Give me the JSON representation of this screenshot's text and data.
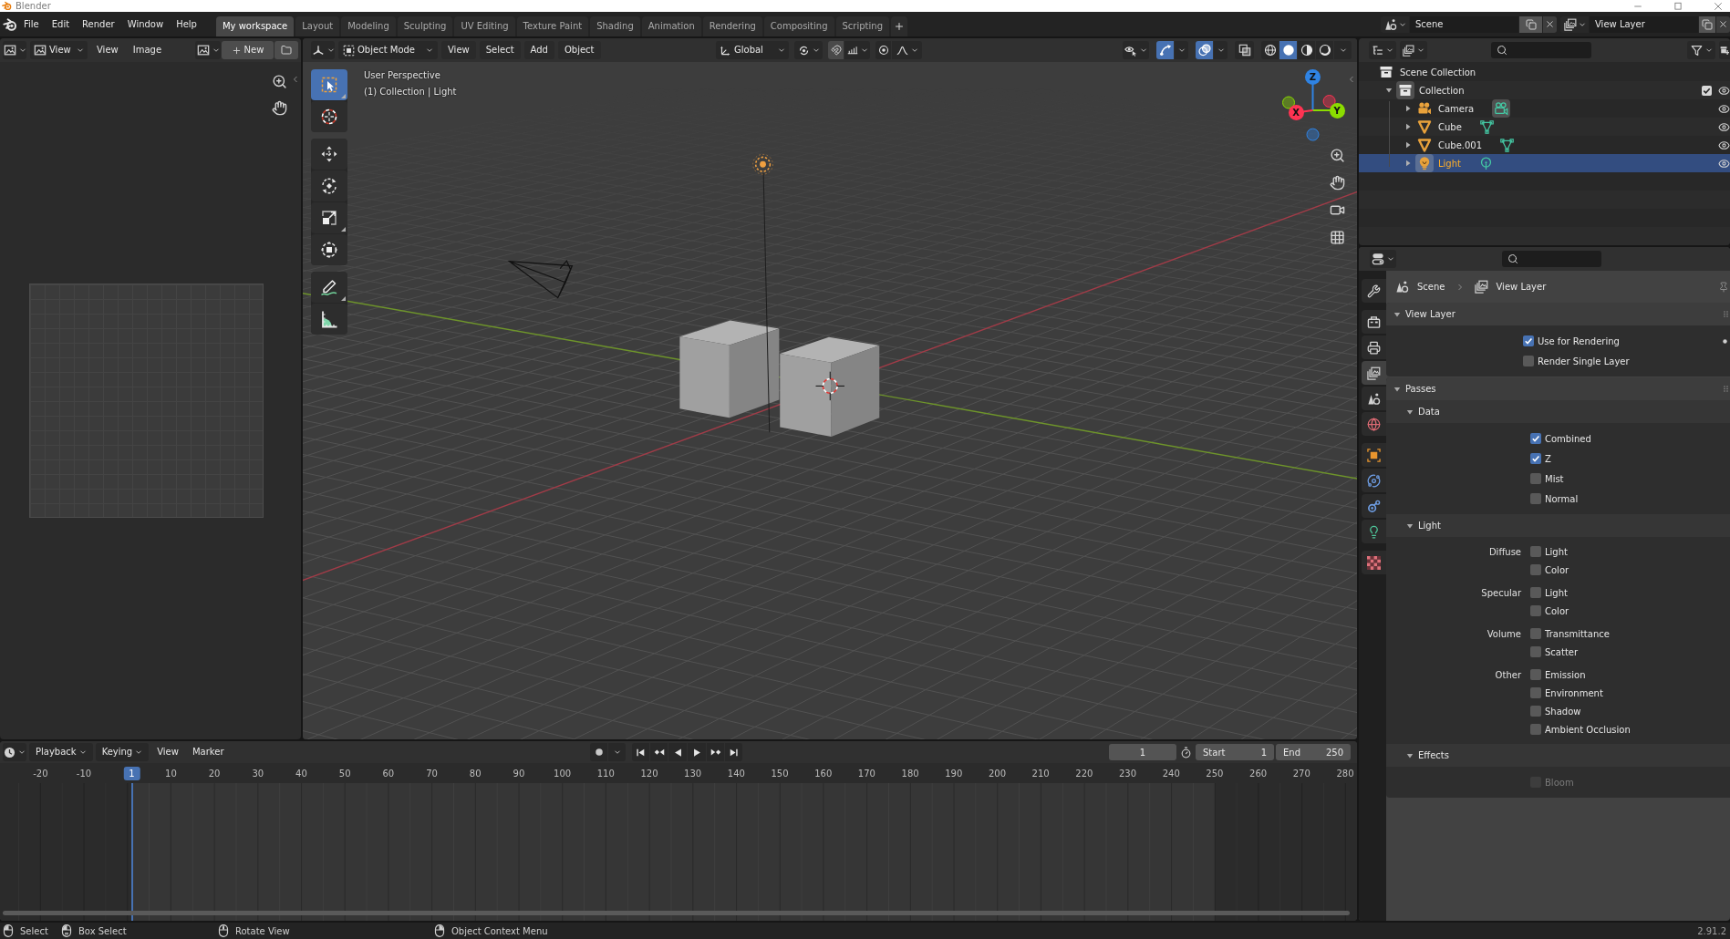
{
  "title_bar": {
    "title": "Blender"
  },
  "top_bar": {
    "menus": [
      "File",
      "Edit",
      "Render",
      "Window",
      "Help"
    ],
    "workspaces": [
      {
        "label": "My workspace",
        "selected": true
      },
      {
        "label": "Layout",
        "selected": false
      },
      {
        "label": "Modeling",
        "selected": false
      },
      {
        "label": "Sculpting",
        "selected": false
      },
      {
        "label": "UV Editing",
        "selected": false
      },
      {
        "label": "Texture Paint",
        "selected": false
      },
      {
        "label": "Shading",
        "selected": false
      },
      {
        "label": "Animation",
        "selected": false
      },
      {
        "label": "Rendering",
        "selected": false
      },
      {
        "label": "Compositing",
        "selected": false
      },
      {
        "label": "Scripting",
        "selected": false
      }
    ],
    "scene": "Scene",
    "view_layer": "View Layer"
  },
  "image_editor": {
    "mode": "View",
    "menus": [
      "View",
      "Image"
    ],
    "new_button": "New"
  },
  "viewport": {
    "mode": "Object Mode",
    "menus": [
      "View",
      "Select",
      "Add",
      "Object"
    ],
    "orientation": "Global",
    "toggles": [
      {
        "kind": "gizmos",
        "on": true
      },
      {
        "kind": "overlays",
        "on": true
      },
      {
        "kind": "xray",
        "on": false
      }
    ],
    "shading": [
      {
        "kind": "wireframe",
        "selected": false
      },
      {
        "kind": "solid",
        "selected": true
      },
      {
        "kind": "material",
        "selected": false
      },
      {
        "kind": "rendered",
        "selected": false
      }
    ],
    "tool_groups": [
      {
        "tools": [
          {
            "kind": "select-box",
            "selected": true,
            "variants": true
          },
          {
            "kind": "cursor",
            "selected": false,
            "variants": false
          }
        ]
      },
      {
        "tools": [
          {
            "kind": "move",
            "selected": false,
            "variants": false
          },
          {
            "kind": "rotate",
            "selected": false,
            "variants": false
          },
          {
            "kind": "scale",
            "selected": false,
            "variants": true
          },
          {
            "kind": "transform",
            "selected": false,
            "variants": false
          }
        ]
      },
      {
        "tools": [
          {
            "kind": "annotate",
            "selected": false,
            "variants": true
          },
          {
            "kind": "measure",
            "selected": false,
            "variants": false
          }
        ]
      }
    ],
    "overlay_text": [
      "User Perspective",
      "(1) Collection | Light"
    ],
    "gizmo_axes": [
      {
        "label": "Z",
        "color": "#2f83e3"
      },
      {
        "label": "Y",
        "color": "#8bdc00"
      },
      {
        "label": "X",
        "color": "#ff3352"
      }
    ]
  },
  "timeline": {
    "menus": [
      {
        "label": "Playback",
        "kind": "dropdown"
      },
      {
        "label": "Keying",
        "kind": "dropdown"
      },
      {
        "label": "View",
        "kind": "menu"
      },
      {
        "label": "Marker",
        "kind": "menu"
      }
    ],
    "auto_keying": {
      "on": false
    },
    "current_frame": "1",
    "start": {
      "label": "Start",
      "value": "1"
    },
    "end": {
      "label": "End",
      "value": "250"
    },
    "ruler": [
      {
        "label": "-20",
        "current": false
      },
      {
        "label": "-10",
        "current": false
      },
      {
        "label": "1",
        "current": true
      },
      {
        "label": "10",
        "current": false
      },
      {
        "label": "20",
        "current": false
      },
      {
        "label": "30",
        "current": false
      },
      {
        "label": "40",
        "current": false
      },
      {
        "label": "50",
        "current": false
      },
      {
        "label": "60",
        "current": false
      },
      {
        "label": "70",
        "current": false
      },
      {
        "label": "80",
        "current": false
      },
      {
        "label": "90",
        "current": false
      },
      {
        "label": "100",
        "current": false
      },
      {
        "label": "110",
        "current": false
      },
      {
        "label": "120",
        "current": false
      },
      {
        "label": "130",
        "current": false
      },
      {
        "label": "140",
        "current": false
      },
      {
        "label": "150",
        "current": false
      },
      {
        "label": "160",
        "current": false
      },
      {
        "label": "170",
        "current": false
      },
      {
        "label": "180",
        "current": false
      },
      {
        "label": "190",
        "current": false
      },
      {
        "label": "200",
        "current": false
      },
      {
        "label": "210",
        "current": false
      },
      {
        "label": "220",
        "current": false
      },
      {
        "label": "230",
        "current": false
      },
      {
        "label": "240",
        "current": false
      },
      {
        "label": "250",
        "current": false
      },
      {
        "label": "260",
        "current": false
      },
      {
        "label": "270",
        "current": false
      },
      {
        "label": "280",
        "current": false
      }
    ]
  },
  "outliner": {
    "tree": [
      {
        "label": "Scene Collection",
        "kind": "scene-collection",
        "selected": false,
        "active": false,
        "children": [
          {
            "label": "Collection",
            "kind": "collection",
            "expanded": true,
            "checked": true,
            "selected": false,
            "active": true,
            "children": [
              {
                "label": "Camera",
                "kind": "camera",
                "expanded": false,
                "selected": false,
                "active": false
              },
              {
                "label": "Cube",
                "kind": "mesh",
                "expanded": false,
                "selected": false,
                "active": false
              },
              {
                "label": "Cube.001",
                "kind": "mesh",
                "expanded": false,
                "selected": false,
                "active": false
              },
              {
                "label": "Light",
                "kind": "light",
                "expanded": false,
                "selected": true,
                "active": true
              }
            ]
          }
        ]
      }
    ]
  },
  "properties": {
    "tab_groups": [
      {
        "tabs": [
          {
            "kind": "tool",
            "selected": false
          }
        ]
      },
      {
        "tabs": [
          {
            "kind": "render",
            "selected": false
          },
          {
            "kind": "output",
            "selected": false
          },
          {
            "kind": "view-layer",
            "selected": true
          },
          {
            "kind": "scene",
            "selected": false
          },
          {
            "kind": "world",
            "selected": false
          }
        ]
      },
      {
        "tabs": [
          {
            "kind": "object",
            "selected": false
          },
          {
            "kind": "physics",
            "selected": false
          },
          {
            "kind": "constraints",
            "selected": false
          },
          {
            "kind": "object-data",
            "selected": false
          }
        ]
      },
      {
        "tabs": [
          {
            "kind": "texture",
            "selected": false
          }
        ]
      }
    ],
    "breadcrumb": [
      {
        "label": "Scene",
        "kind": "scene"
      },
      {
        "label": "View Layer",
        "kind": "view-layer"
      }
    ],
    "panels": [
      {
        "title": "View Layer",
        "expanded": true,
        "groups": [
          {
            "options": [
              {
                "label": "Use for Rendering",
                "checked": true,
                "disabled": false,
                "animatable": true
              },
              {
                "label": "Render Single Layer",
                "checked": false,
                "disabled": false,
                "animatable": false
              }
            ]
          }
        ]
      },
      {
        "title": "Passes",
        "expanded": true,
        "subpanels": [
          {
            "title": "Data",
            "expanded": true,
            "groups": [
              {
                "options": [
                  {
                    "label": "Combined",
                    "checked": true,
                    "disabled": false
                  },
                  {
                    "label": "Z",
                    "checked": true,
                    "disabled": false
                  },
                  {
                    "label": "Mist",
                    "checked": false,
                    "disabled": false
                  },
                  {
                    "label": "Normal",
                    "checked": false,
                    "disabled": false
                  }
                ]
              }
            ]
          },
          {
            "title": "Light",
            "expanded": true,
            "groups": [
              {
                "label": "Diffuse",
                "options": [
                  {
                    "label": "Light",
                    "checked": false,
                    "disabled": false
                  },
                  {
                    "label": "Color",
                    "checked": false,
                    "disabled": false
                  }
                ]
              },
              {
                "label": "Specular",
                "options": [
                  {
                    "label": "Light",
                    "checked": false,
                    "disabled": false
                  },
                  {
                    "label": "Color",
                    "checked": false,
                    "disabled": false
                  }
                ]
              },
              {
                "label": "Volume",
                "options": [
                  {
                    "label": "Transmittance",
                    "checked": false,
                    "disabled": false
                  },
                  {
                    "label": "Scatter",
                    "checked": false,
                    "disabled": false
                  }
                ]
              },
              {
                "label": "Other",
                "options": [
                  {
                    "label": "Emission",
                    "checked": false,
                    "disabled": false
                  },
                  {
                    "label": "Environment",
                    "checked": false,
                    "disabled": false
                  },
                  {
                    "label": "Shadow",
                    "checked": false,
                    "disabled": false
                  },
                  {
                    "label": "Ambient Occlusion",
                    "checked": false,
                    "disabled": false
                  }
                ]
              }
            ]
          },
          {
            "title": "Effects",
            "expanded": true,
            "groups": [
              {
                "options": [
                  {
                    "label": "Bloom",
                    "checked": false,
                    "disabled": true
                  }
                ]
              }
            ]
          }
        ]
      }
    ]
  },
  "status_bar": {
    "hints": [
      {
        "kind": "left-click",
        "label": "Select"
      },
      {
        "kind": "left-drag",
        "label": "Box Select"
      },
      {
        "kind": "middle-drag",
        "label": "Rotate View"
      },
      {
        "kind": "right-click",
        "label": "Object Context Menu"
      }
    ],
    "version": "2.91.2"
  }
}
